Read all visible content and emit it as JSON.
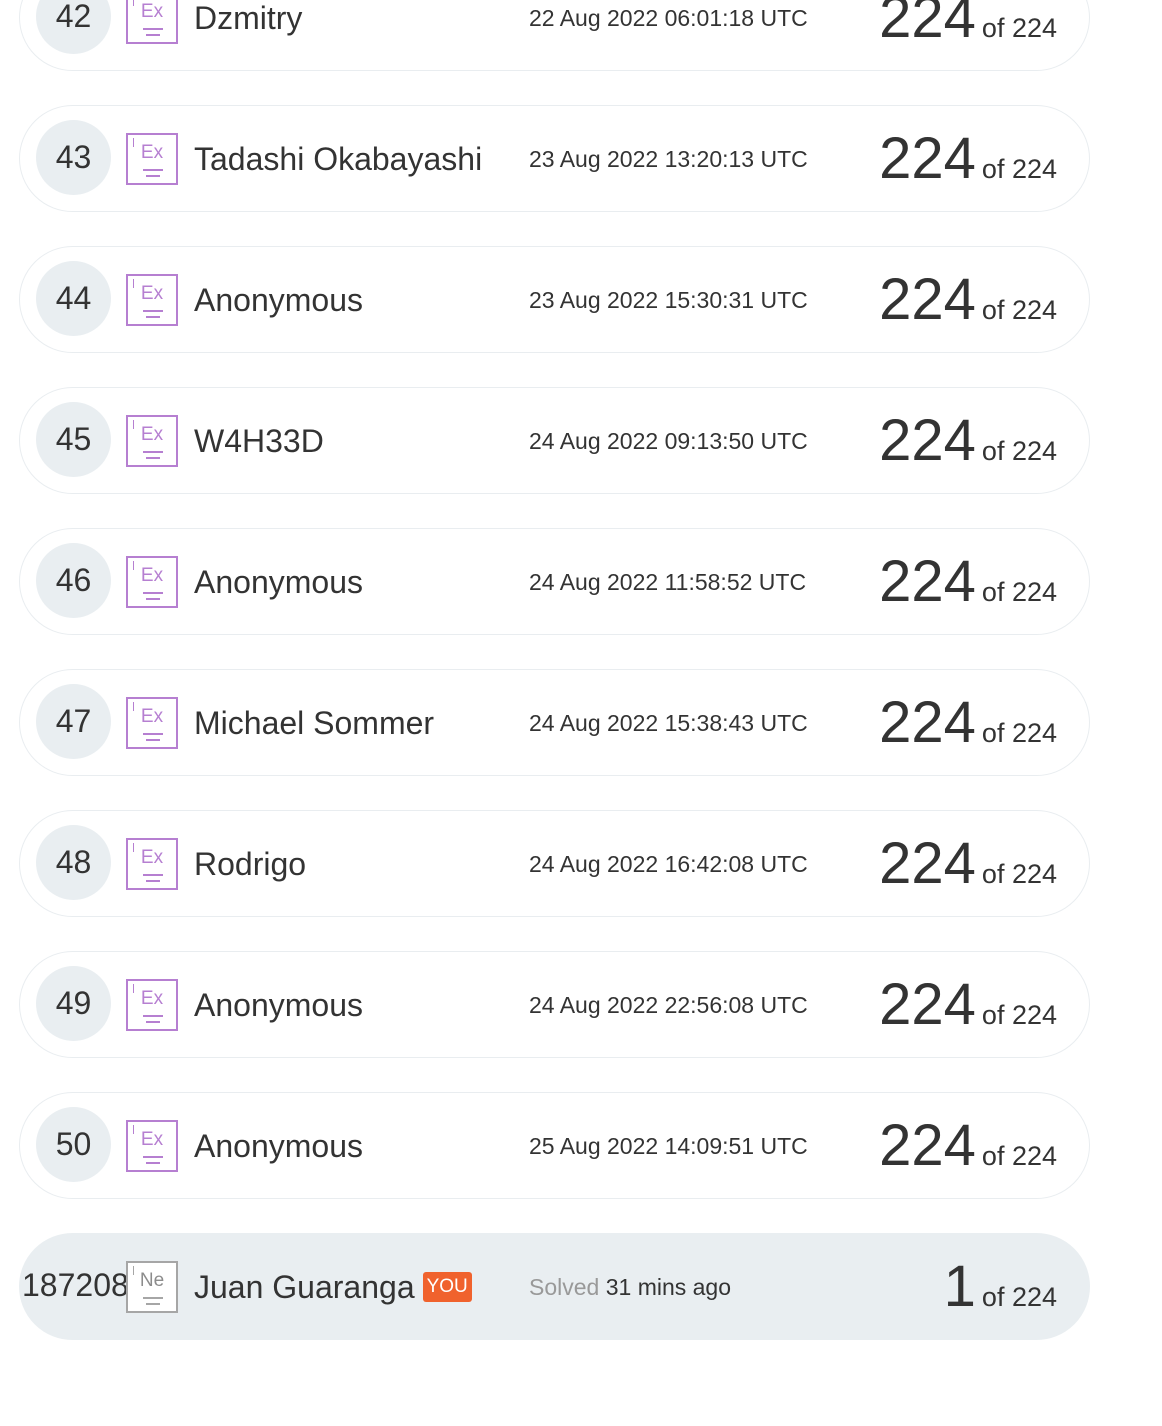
{
  "leaderboard": {
    "rows": [
      {
        "rank": "42",
        "badge": "Ex",
        "name": "Dzmitry",
        "timestamp": "22 Aug 2022 06:01:18 UTC",
        "solved": "224",
        "of_total": "of 224"
      },
      {
        "rank": "43",
        "badge": "Ex",
        "name": "Tadashi Okabayashi",
        "timestamp": "23 Aug 2022 13:20:13 UTC",
        "solved": "224",
        "of_total": "of 224"
      },
      {
        "rank": "44",
        "badge": "Ex",
        "name": "Anonymous",
        "timestamp": "23 Aug 2022 15:30:31 UTC",
        "solved": "224",
        "of_total": "of 224"
      },
      {
        "rank": "45",
        "badge": "Ex",
        "name": "W4H33D",
        "timestamp": "24 Aug 2022 09:13:50 UTC",
        "solved": "224",
        "of_total": "of 224"
      },
      {
        "rank": "46",
        "badge": "Ex",
        "name": "Anonymous",
        "timestamp": "24 Aug 2022 11:58:52 UTC",
        "solved": "224",
        "of_total": "of 224"
      },
      {
        "rank": "47",
        "badge": "Ex",
        "name": "Michael Sommer",
        "timestamp": "24 Aug 2022 15:38:43 UTC",
        "solved": "224",
        "of_total": "of 224"
      },
      {
        "rank": "48",
        "badge": "Ex",
        "name": "Rodrigo",
        "timestamp": "24 Aug 2022 16:42:08 UTC",
        "solved": "224",
        "of_total": "of 224"
      },
      {
        "rank": "49",
        "badge": "Ex",
        "name": "Anonymous",
        "timestamp": "24 Aug 2022 22:56:08 UTC",
        "solved": "224",
        "of_total": "of 224"
      },
      {
        "rank": "50",
        "badge": "Ex",
        "name": "Anonymous",
        "timestamp": "25 Aug 2022 14:09:51 UTC",
        "solved": "224",
        "of_total": "of 224"
      }
    ],
    "current_user": {
      "rank": "187208",
      "badge": "Ne",
      "name": "Juan Guaranga",
      "you_tag": "YOU",
      "solved_label": "Solved",
      "solved_ago": "31 mins ago",
      "solved": "1",
      "of_total": "of 224"
    }
  },
  "colors": {
    "expert_badge": "#b67fd1",
    "newbie_badge": "#a6a6a6",
    "you_tag": "#f0622d",
    "row_highlight": "#e9eef1"
  },
  "icons": {
    "expert_badge": "expert-level-badge-icon",
    "newbie_badge": "newbie-level-badge-icon"
  }
}
